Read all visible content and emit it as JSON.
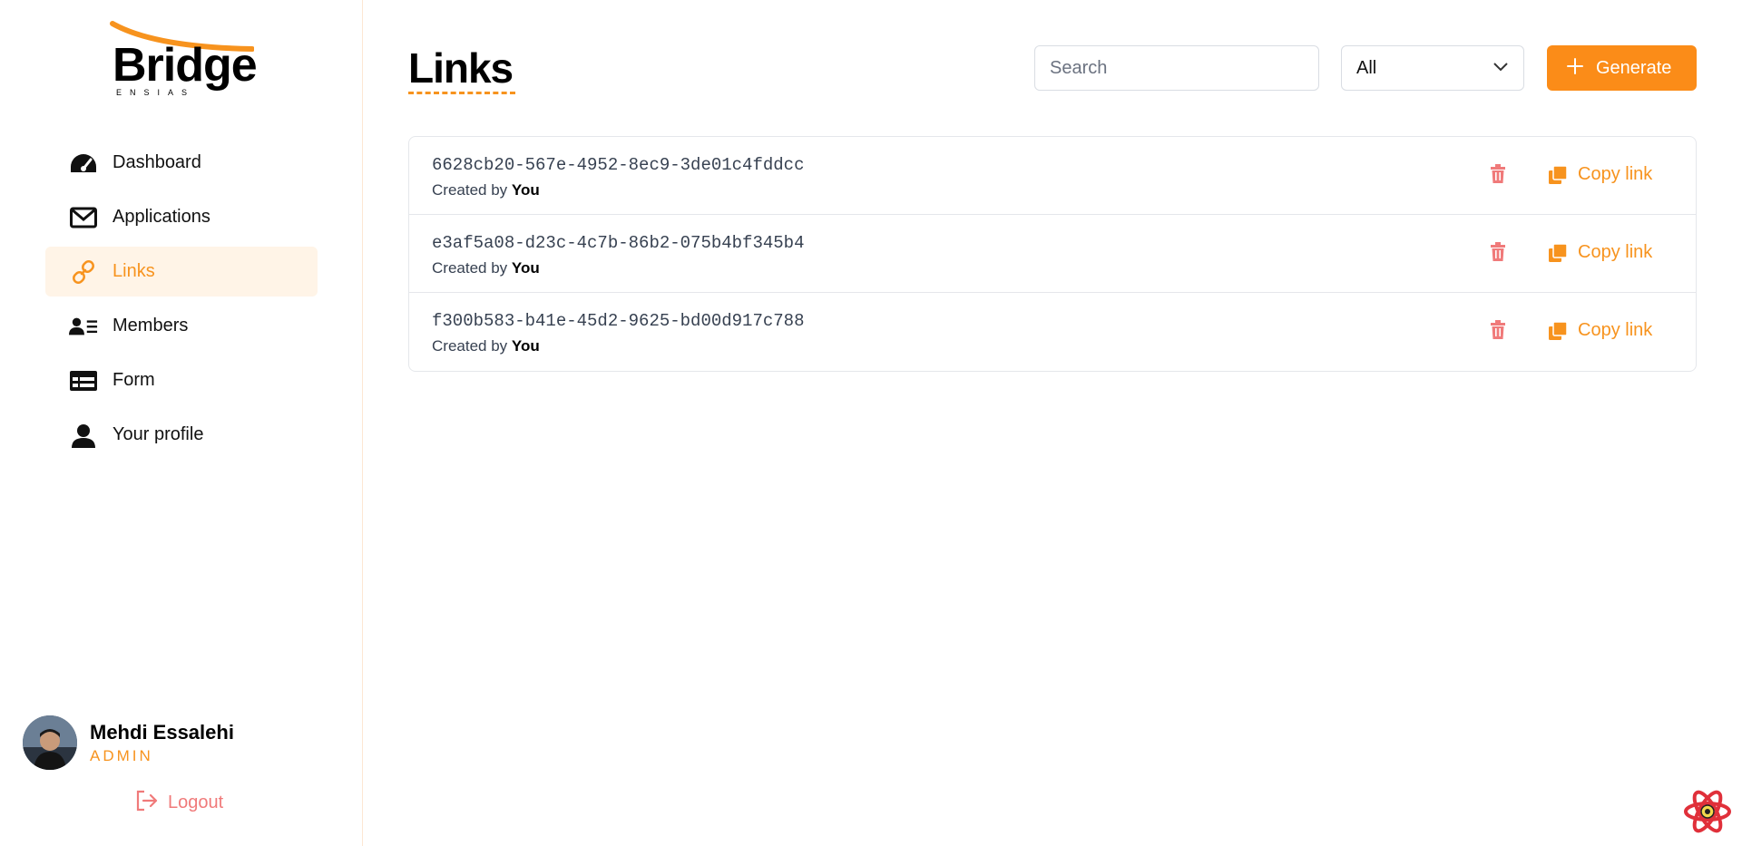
{
  "brand": {
    "name": "Bridge",
    "sub": "ENSIAS",
    "accent": "#f7931e"
  },
  "sidebar": {
    "items": [
      {
        "label": "Dashboard",
        "icon": "gauge-icon",
        "active": false
      },
      {
        "label": "Applications",
        "icon": "envelope-icon",
        "active": false
      },
      {
        "label": "Links",
        "icon": "link-icon",
        "active": true
      },
      {
        "label": "Members",
        "icon": "members-icon",
        "active": false
      },
      {
        "label": "Form",
        "icon": "form-icon",
        "active": false
      },
      {
        "label": "Your profile",
        "icon": "user-icon",
        "active": false
      }
    ],
    "user": {
      "name": "Mehdi Essalehi",
      "role": "ADMIN"
    },
    "logout_label": "Logout"
  },
  "main": {
    "title": "Links",
    "search": {
      "placeholder": "Search",
      "value": ""
    },
    "filter": {
      "value": "All"
    },
    "generate_label": "Generate",
    "links": [
      {
        "id": "6628cb20-567e-4952-8ec9-3de01c4fddcc",
        "created_prefix": "Created by",
        "created_by": "You",
        "copy_label": "Copy link"
      },
      {
        "id": "e3af5a08-d23c-4c7b-86b2-075b4bf345b4",
        "created_prefix": "Created by",
        "created_by": "You",
        "copy_label": "Copy link"
      },
      {
        "id": "f300b583-b41e-45d2-9625-bd00d917c788",
        "created_prefix": "Created by",
        "created_by": "You",
        "copy_label": "Copy link"
      }
    ]
  },
  "colors": {
    "accent": "#fb8c18",
    "danger": "#f07a7a",
    "border": "#e5e7eb"
  }
}
